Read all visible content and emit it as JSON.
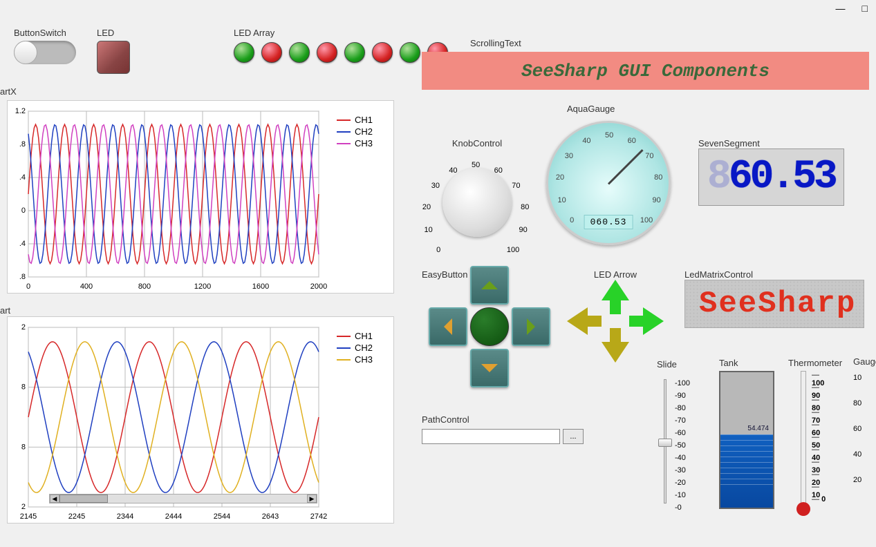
{
  "titlebar": {
    "minimize": "—",
    "maximize": "□"
  },
  "top": {
    "buttonSwitchLabel": "ButtonSwitch",
    "ledLabel": "LED",
    "ledArrayLabel": "LED Array"
  },
  "ledArrayStates": [
    "green",
    "red",
    "green",
    "red",
    "green",
    "red",
    "green",
    "red"
  ],
  "scrolling": {
    "label": "ScrollingText",
    "text": "SeeSharp GUI Components"
  },
  "knob": {
    "label": "KnobControl",
    "ticks": [
      "0",
      "10",
      "20",
      "30",
      "40",
      "50",
      "60",
      "70",
      "80",
      "90",
      "100"
    ]
  },
  "gauge": {
    "label": "AquaGauge",
    "value": "060.53",
    "min": "0",
    "max": "100",
    "ticks": [
      "0",
      "10",
      "20",
      "30",
      "40",
      "50",
      "60",
      "70",
      "80",
      "90",
      "100"
    ]
  },
  "seven": {
    "label": "SevenSegment",
    "value": "60.53",
    "ghost": "8"
  },
  "easy": {
    "label": "EasyButton"
  },
  "ledArrow": {
    "label": "LED Arrow"
  },
  "matrix": {
    "label": "LedMatrixControl",
    "text": "SeeSharp"
  },
  "slide": {
    "label": "Slide",
    "ticks": [
      "-100",
      "-90",
      "-80",
      "-70",
      "-60",
      "-50",
      "-40",
      "-30",
      "-20",
      "-10",
      "-0"
    ],
    "value": -50
  },
  "tank": {
    "label": "Tank",
    "value_label": "54.474",
    "fill_pct": 54
  },
  "thermo": {
    "label": "Thermometer",
    "ticks": [
      "100",
      "90",
      "80",
      "70",
      "60",
      "50",
      "40",
      "30",
      "20",
      "10",
      "0"
    ]
  },
  "gauge2": {
    "label": "Gauge",
    "ticks": [
      "10",
      "80",
      "60",
      "40",
      "20"
    ]
  },
  "path": {
    "label": "PathControl",
    "value": "",
    "browse": "..."
  },
  "chartXLabel": "artX",
  "chartLabel": "art",
  "legend": {
    "ch1": "CH1",
    "ch2": "CH2",
    "ch3": "CH3"
  },
  "chart_data": [
    {
      "type": "line",
      "title": "artX",
      "xlim": [
        0,
        2000
      ],
      "ylim": [
        -1.2,
        1.2
      ],
      "xticks": [
        "0",
        "400",
        "800",
        "1200",
        "1600",
        "2000"
      ],
      "yticks": [
        "1.2",
        ".8",
        ".4",
        "0",
        ".4",
        ".8"
      ],
      "series": [
        {
          "name": "CH1",
          "color": "#d62728",
          "desc": "sine wave ~10 periods over 0-2000, amplitude 1.0"
        },
        {
          "name": "CH2",
          "color": "#1f3fc0",
          "desc": "sine wave same freq, phase offset ~+120deg"
        },
        {
          "name": "CH3",
          "color": "#d040c0",
          "desc": "sine wave same freq, phase offset ~-120deg"
        }
      ]
    },
    {
      "type": "line",
      "title": "art",
      "xlim": [
        2145,
        2742
      ],
      "ylim": [
        -1.2,
        1.2
      ],
      "xticks": [
        "2145",
        "2245",
        "2344",
        "2444",
        "2544",
        "2643",
        "2742"
      ],
      "yticks": [
        "2",
        "8",
        "8",
        "2"
      ],
      "series": [
        {
          "name": "CH1",
          "color": "#d62728",
          "desc": "sine wave ~3 periods"
        },
        {
          "name": "CH2",
          "color": "#1f3fc0",
          "desc": "sine phase offset"
        },
        {
          "name": "CH3",
          "color": "#e0b020",
          "desc": "sine phase offset"
        }
      ]
    }
  ]
}
